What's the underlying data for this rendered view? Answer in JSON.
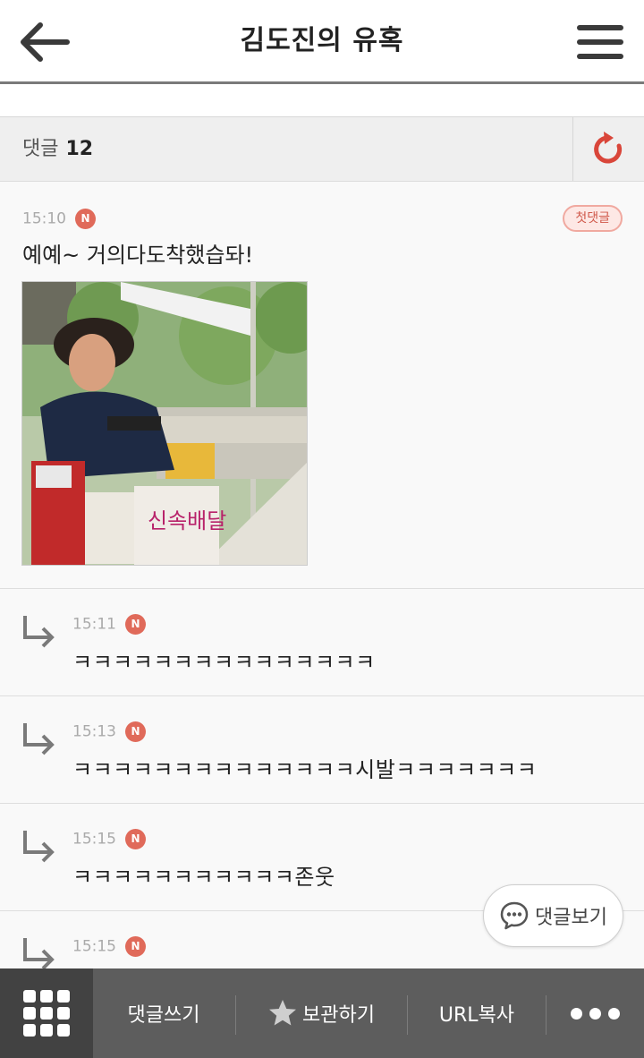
{
  "header": {
    "title": "김도진의 유혹",
    "back_icon": "arrow-left-icon",
    "menu_icon": "hamburger-menu-icon"
  },
  "comments_bar": {
    "label": "댓글",
    "count": "12",
    "refresh_icon": "refresh-icon",
    "accent_color": "#d9463a"
  },
  "comments": [
    {
      "time": "15:10",
      "badge": "N",
      "first_label": "첫댓글",
      "text": "예예~ 거의다도착했습돠!",
      "has_image": true
    }
  ],
  "replies": [
    {
      "time": "15:11",
      "badge": "N",
      "text": "ㅋㅋㅋㅋㅋㅋㅋㅋㅋㅋㅋㅋㅋㅋㅋ"
    },
    {
      "time": "15:13",
      "badge": "N",
      "text": "ㅋㅋㅋㅋㅋㅋㅋㅋㅋㅋㅋㅋㅋㅋ시발ㅋㅋㅋㅋㅋㅋㅋ"
    },
    {
      "time": "15:15",
      "badge": "N",
      "text": "ㅋㅋㅋㅋㅋㅋㅋㅋㅋㅋㅋ존웃"
    },
    {
      "time": "15:15",
      "badge": "N",
      "text": ""
    }
  ],
  "view_comments_button": {
    "label": "댓글보기",
    "icon": "chat-bubble-icon"
  },
  "toolbar": {
    "grid_icon": "grid-apps-icon",
    "write_label": "댓글쓰기",
    "bookmark_label": "보관하기",
    "bookmark_icon": "star-icon",
    "copy_url_label": "URL복사",
    "more_icon": "more-dots-icon"
  }
}
